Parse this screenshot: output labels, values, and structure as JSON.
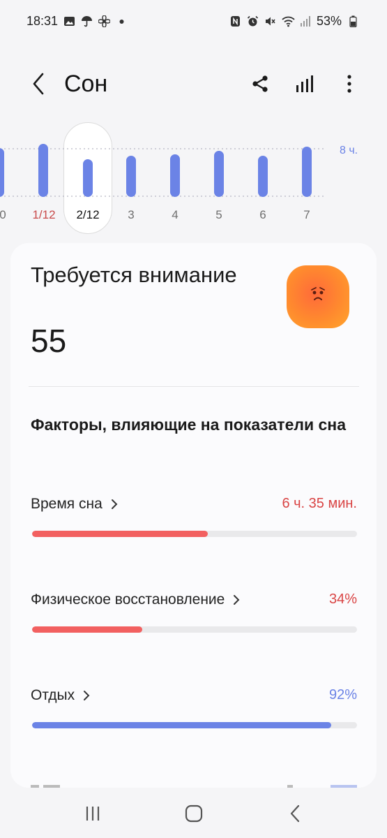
{
  "status_bar": {
    "time": "18:31",
    "battery": "53%",
    "left_icons": [
      "image-icon",
      "umbrella-icon",
      "fan-icon",
      "dot-icon"
    ],
    "right_icons": [
      "nfc-icon",
      "alarm-icon",
      "mute-icon",
      "wifi-icon",
      "signal-icon",
      "battery-icon"
    ]
  },
  "header": {
    "title": "Сон",
    "actions": [
      "share-icon",
      "stats-icon",
      "more-icon"
    ]
  },
  "chart_data": {
    "type": "bar",
    "categories": [
      "0",
      "1/12",
      "2/12",
      "3",
      "4",
      "5",
      "6",
      "7"
    ],
    "selected": "2/12",
    "highlighted": "1/12",
    "goal_label": "8 ч.",
    "bar_color": "#6b83e6"
  },
  "card": {
    "status_title": "Требуется внимание",
    "score": "55",
    "mood_icon": "sad-face-icon",
    "section_title": "Факторы, влияющие на показатели сна",
    "factors": [
      {
        "label": "Время сна",
        "value": "6 ч. 35 мин.",
        "progress": 0.54,
        "color": "#f26060",
        "value_color": "#d94444"
      },
      {
        "label": "Физическое восстановление",
        "value": "34%",
        "progress": 0.34,
        "color": "#f26060",
        "value_color": "#d94444"
      },
      {
        "label": "Отдых",
        "value": "92%",
        "progress": 0.92,
        "color": "#6b83e6",
        "value_color": "#6b83e6"
      }
    ]
  },
  "nav": [
    "recents-icon",
    "home-icon",
    "back-icon"
  ]
}
